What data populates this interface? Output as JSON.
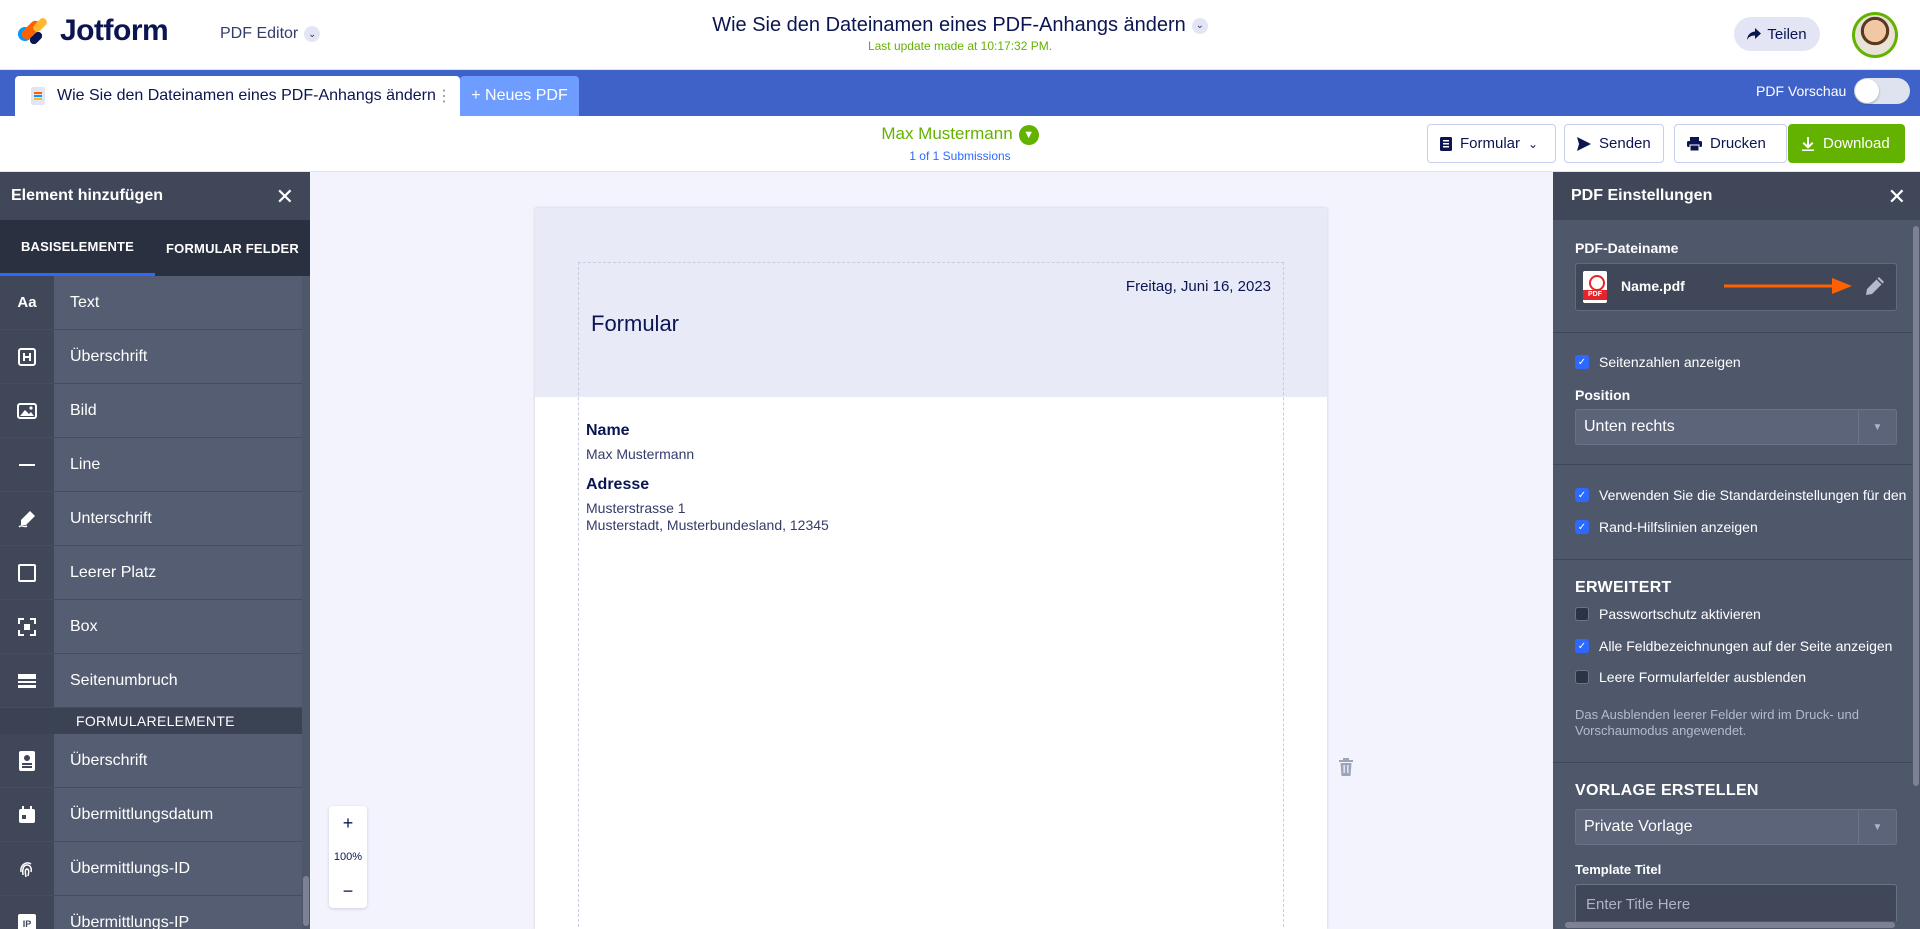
{
  "header": {
    "logo_text": "Jotform",
    "app_name": "PDF Editor",
    "doc_title": "Wie Sie den Dateinamen eines PDF-Anhangs ändern",
    "last_update": "Last update made at 10:17:32 PM.",
    "share_label": "Teilen"
  },
  "tabs": {
    "doc_tab_label": "Wie Sie den Dateinamen eines PDF-Anhangs ändern",
    "new_pdf_label": "+ Neues PDF",
    "preview_label": "PDF Vorschau"
  },
  "submission": {
    "name": "Max Mustermann",
    "count": "1 of 1 Submissions"
  },
  "toolbar": {
    "form_label": "Formular",
    "send_label": "Senden",
    "print_label": "Drucken",
    "download_label": "Download"
  },
  "left_panel": {
    "title": "Element hinzufügen",
    "tab_basic": "BASISELEMENTE",
    "tab_form_fields": "FORMULAR FELDER",
    "basic_items": [
      {
        "icon": "Aa",
        "label": "Text"
      },
      {
        "icon": "heading-icon",
        "label": "Überschrift"
      },
      {
        "icon": "image-icon",
        "label": "Bild"
      },
      {
        "icon": "line-icon",
        "label": "Line"
      },
      {
        "icon": "signature-icon",
        "label": "Unterschrift"
      },
      {
        "icon": "empty-space-icon",
        "label": "Leerer Platz"
      },
      {
        "icon": "box-icon",
        "label": "Box"
      },
      {
        "icon": "page-break-icon",
        "label": "Seitenumbruch"
      }
    ],
    "section_label": "FORMULARELEMENTE",
    "form_items": [
      {
        "icon": "form-heading-icon",
        "label": "Überschrift"
      },
      {
        "icon": "calendar-icon",
        "label": "Übermittlungsdatum"
      },
      {
        "icon": "fingerprint-icon",
        "label": "Übermittlungs-ID"
      },
      {
        "icon": "ip-icon",
        "label": "Übermittlungs-IP"
      }
    ]
  },
  "canvas": {
    "date": "Freitag, Juni 16, 2023",
    "title": "Formular",
    "name_label": "Name",
    "name_value": "Max Mustermann",
    "address_label": "Adresse",
    "address_line1": "Musterstrasse 1",
    "address_line2": "Musterstadt, Musterbundesland, 12345",
    "zoom_level": "100%"
  },
  "right_panel": {
    "title": "PDF Einstellungen",
    "filename_label": "PDF-Dateiname",
    "filename": "Name.pdf",
    "show_page_numbers": "Seitenzahlen anzeigen",
    "position_label": "Position",
    "position_value": "Unten rechts",
    "use_defaults": "Verwenden Sie die Standardeinstellungen für den",
    "show_guides": "Rand-Hilfslinien anzeigen",
    "advanced_heading": "ERWEITERT",
    "password_protect": "Passwortschutz aktivieren",
    "show_all_labels": "Alle Feldbezeichnungen auf der Seite anzeigen",
    "hide_empty": "Leere Formularfelder ausblenden",
    "hide_empty_hint": "Das Ausblenden leerer Felder wird im Druck- und Vorschaumodus angewendet.",
    "template_heading": "VORLAGE ERSTELLEN",
    "template_type": "Private Vorlage",
    "template_title_label": "Template Titel",
    "template_title_placeholder": "Enter Title Here"
  },
  "colors": {
    "brand_blue": "#3e62c8",
    "accent_green": "#64b200",
    "panel_dark": "#4f576b",
    "arrow_orange": "#ff6100"
  }
}
